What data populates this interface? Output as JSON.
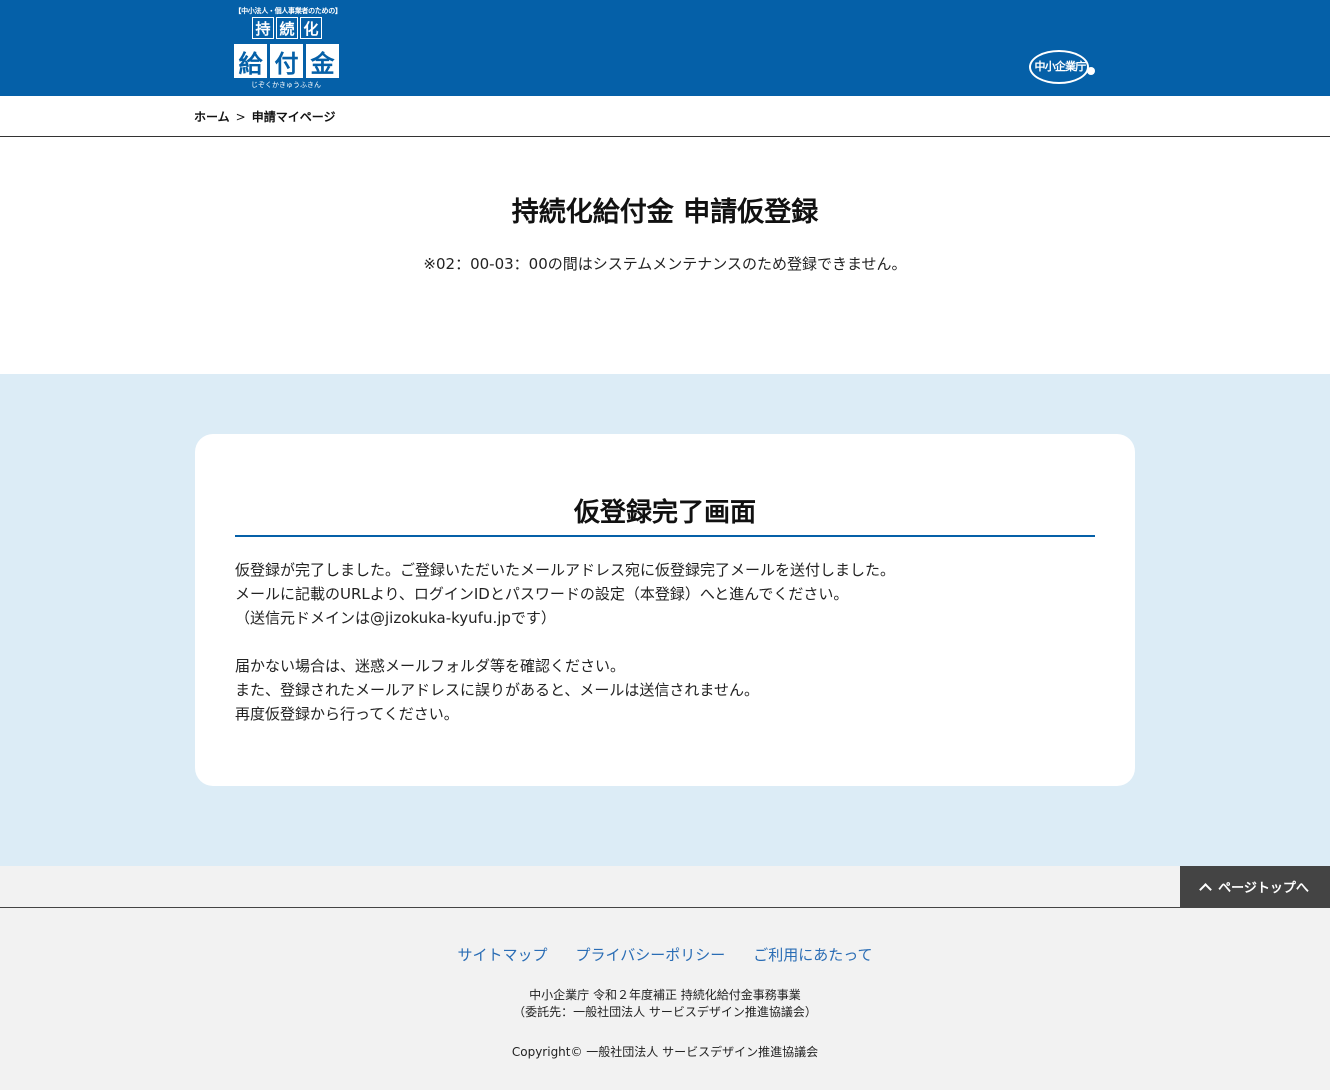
{
  "header": {
    "logo": {
      "top_text": "【中小法人・個人事業者のための】",
      "row1": [
        "持",
        "続",
        "化"
      ],
      "row2": [
        "給",
        "付",
        "金"
      ],
      "bottom_text": "じぞくかきゅうふきん"
    },
    "agency_logo_text": "中小企業庁",
    "background_color": "#0560a8"
  },
  "breadcrumb": {
    "home": "ホーム",
    "separator": ">",
    "current": "申請マイページ"
  },
  "main": {
    "title": "持続化給付金 申請仮登録",
    "notice": "※02：00-03：00の間はシステムメンテナンスのため登録できません。"
  },
  "card": {
    "title": "仮登録完了画面",
    "paragraph1": [
      "仮登録が完了しました。ご登録いただいたメールアドレス宛に仮登録完了メールを送付しました。",
      "メールに記載のURLより、ログインIDとパスワードの設定（本登録）へと進んでください。",
      "（送信元ドメインは@jizokuka-kyufu.jpです）"
    ],
    "paragraph2": [
      "届かない場合は、迷惑メールフォルダ等を確認ください。",
      "また、登録されたメールアドレスに誤りがあると、メールは送信されません。",
      "再度仮登録から行ってください。"
    ],
    "section_background": "#dcecf6"
  },
  "footer": {
    "page_top_label": "ページトップへ",
    "links": [
      "サイトマップ",
      "プライバシーポリシー",
      "ご利用にあたって"
    ],
    "org_line1": "中小企業庁 令和２年度補正 持続化給付金事務事業",
    "org_line2": "（委託先：一般社団法人 サービスデザイン推進協議会）",
    "copyright": "Copyright© 一般社団法人 サービスデザイン推進協議会",
    "link_color": "#2a6db5"
  },
  "icons": {
    "page_top": "chevron-up-icon"
  }
}
